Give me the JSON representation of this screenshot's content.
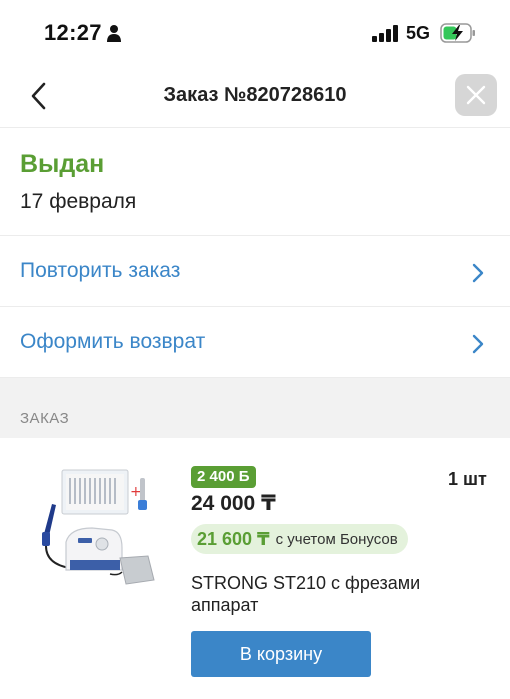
{
  "status_bar": {
    "time": "12:27",
    "network": "5G"
  },
  "header": {
    "title": "Заказ №820728610"
  },
  "order": {
    "status": "Выдан",
    "status_color": "#5a9e34",
    "date": "17 февраля"
  },
  "actions": [
    {
      "label": "Повторить заказ"
    },
    {
      "label": "Оформить возврат"
    }
  ],
  "section": {
    "title": "ЗАКАЗ"
  },
  "product": {
    "bonus_badge": "2 400 Б",
    "price": "24 000 ₸",
    "quantity": "1 шт",
    "bonus_price": "21 600 ₸",
    "bonus_note": "с учетом Бонусов",
    "name": "STRONG ST210 с фрезами аппарат",
    "cart_label": "В корзину"
  },
  "colors": {
    "accent": "#3b86c8",
    "success": "#5a9e34",
    "close_bg": "#d6d6d6"
  }
}
